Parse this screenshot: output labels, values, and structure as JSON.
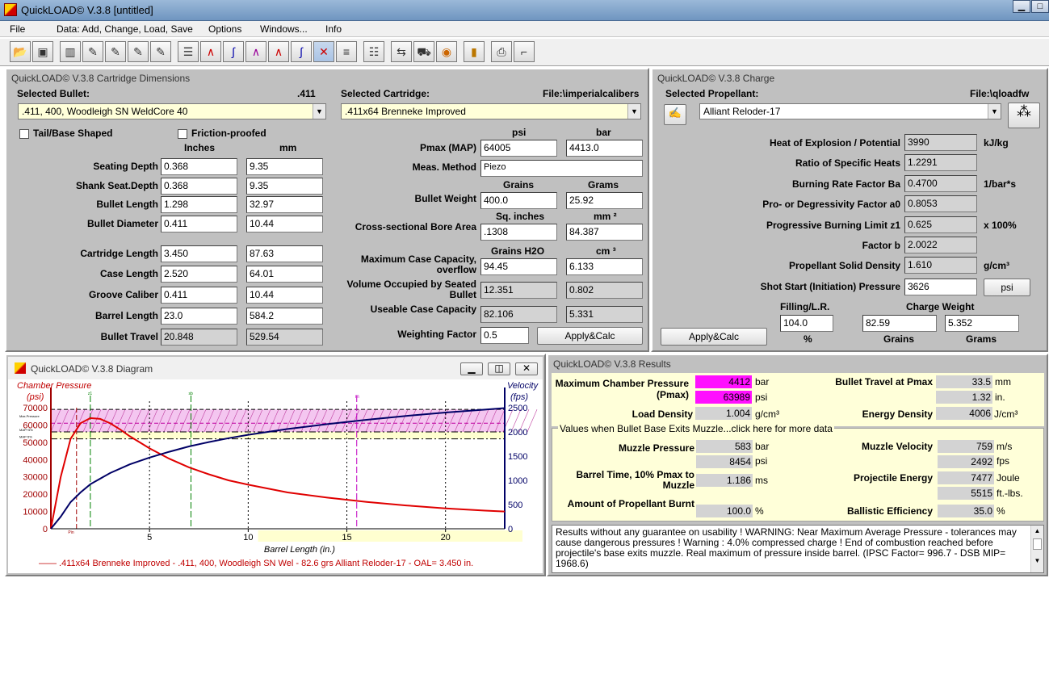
{
  "window": {
    "title": "QuickLOAD© V.3.8   [untitled]",
    "minimize": "▁",
    "maximize": "□"
  },
  "menu": [
    "File",
    "Data: Add, Change, Load, Save",
    "Options",
    "Windows...",
    "Info"
  ],
  "toolbar": {
    "icons": [
      "open-icon",
      "save-icon",
      "library-icon",
      "edit-bullet-icon",
      "edit-cartridge-icon",
      "edit-powder-icon",
      "edit-list-icon",
      "table-icon",
      "pressure-curve-icon",
      "velocity-curve-icon",
      "combined-curve-icon",
      "energy-curve-icon",
      "time-curve-icon",
      "diagram-icon",
      "list-icon",
      "sheet-icon",
      "compare-icon",
      "truck-icon",
      "bell-icon",
      "cartridges-icon",
      "printer-icon",
      "pistol-icon"
    ]
  },
  "dims": {
    "title": "QuickLOAD© V.3.8 Cartridge Dimensions",
    "bullet_label": "Selected Bullet:",
    "bullet_cal": ".411",
    "bullet": ".411, 400, Woodleigh SN WeldCore 40",
    "cart_label": "Selected Cartridge:",
    "cart_file": "File:\\imperialcalibers",
    "cartridge": ".411x64 Brenneke Improved",
    "tail": "Tail/Base Shaped",
    "friction": "Friction-proofed",
    "inches": "Inches",
    "mm": "mm",
    "rows": [
      {
        "label": "Seating Depth",
        "in": "0.368",
        "mm": "9.35"
      },
      {
        "label": "Shank Seat.Depth",
        "in": "0.368",
        "mm": "9.35"
      },
      {
        "label": "Bullet Length",
        "in": "1.298",
        "mm": "32.97"
      },
      {
        "label": "Bullet Diameter",
        "in": "0.411",
        "mm": "10.44"
      },
      {
        "label": "Cartridge Length",
        "in": "3.450",
        "mm": "87.63"
      },
      {
        "label": "Case Length",
        "in": "2.520",
        "mm": "64.01"
      },
      {
        "label": "Groove Caliber",
        "in": "0.411",
        "mm": "10.44"
      },
      {
        "label": "Barrel Length",
        "in": "23.0",
        "mm": "584.2"
      },
      {
        "label": "Bullet Travel",
        "in": "20.848",
        "mm": "529.54"
      }
    ],
    "psi": "psi",
    "bar": "bar",
    "pmax_label": "Pmax (MAP)",
    "pmax_psi": "64005",
    "pmax_bar": "4413.0",
    "meas_label": "Meas. Method",
    "meas": "Piezo",
    "grains": "Grains",
    "grams": "Grams",
    "bw_label": "Bullet Weight",
    "bw_gr": "400.0",
    "bw_g": "25.92",
    "sqin": "Sq. inches",
    "mm2": "mm ²",
    "bore_label": "Cross-sectional Bore Area",
    "bore_in": ".1308",
    "bore_mm": "84.387",
    "gh2o": "Grains H2O",
    "cm3": "cm ³",
    "cap_label1": "Maximum Case Capacity,",
    "cap_label2": "overflow",
    "cap_gr": "94.45",
    "cap_cm": "6.133",
    "vol_label1": "Volume Occupied by Seated",
    "vol_label2": "Bullet",
    "vol_gr": "12.351",
    "vol_cm": "0.802",
    "use_label": "Useable Case Capacity",
    "use_gr": "82.106",
    "use_cm": "5.331",
    "wf_label": "Weighting Factor",
    "wf": "0.5",
    "apply": "Apply&Calc"
  },
  "charge": {
    "title": "QuickLOAD© V.3.8 Charge",
    "prop_label": "Selected Propellant:",
    "file": "File:\\qloadfw",
    "propellant": "Alliant Reloder-17",
    "rows": [
      {
        "label": "Heat of Explosion / Potential",
        "value": "3990",
        "unit": "kJ/kg"
      },
      {
        "label": "Ratio of Specific Heats",
        "value": "1.2291",
        "unit": ""
      },
      {
        "label": "Burning Rate Factor  Ba",
        "value": "0.4700",
        "unit": "1/bar*s"
      },
      {
        "label": "Pro- or Degressivity Factor  a0",
        "value": "0.8053",
        "unit": ""
      },
      {
        "label": "Progressive Burning Limit z1",
        "value": "0.625",
        "unit": "x 100%"
      },
      {
        "label": "Factor  b",
        "value": "2.0022",
        "unit": ""
      },
      {
        "label": "Propellant Solid Density",
        "value": "1.610",
        "unit": "g/cm³"
      }
    ],
    "shot_label": "Shot Start (Initiation) Pressure",
    "shot": "3626",
    "shot_unit": "psi",
    "fill_label": "Filling/L.R.",
    "fill": "104.0",
    "pct": "%",
    "cw_label": "Charge Weight",
    "cw_gr": "82.59",
    "cw_g": "5.352",
    "grains": "Grains",
    "grams": "Grams",
    "apply": "Apply&Calc"
  },
  "diagram": {
    "title": "QuickLOAD© V.3.8 Diagram",
    "legend": "——  .411x64 Brenneke Improved - .411, 400, Woodleigh SN Wel - 82.6 grs Alliant Reloder-17 - OAL= 3.450 in.",
    "small_labels": {
      "z1": "z1",
      "sb": "sb",
      "m": "m",
      "pin": "Pin",
      "max": "Max.Pressure",
      "map": "MAP+5%",
      "mapm": "MAP-5%"
    }
  },
  "chart_data": {
    "type": "line",
    "title": "",
    "xlabel": "Barrel Length (in.)",
    "ylabel": "Chamber Pressure (psi)",
    "y2label": "Velocity (fps)",
    "xlim": [
      0,
      23
    ],
    "ylim": [
      0,
      70000
    ],
    "y2lim": [
      0,
      2500
    ],
    "xticks": [
      "5",
      "10",
      "15",
      "20"
    ],
    "yticks": [
      "0",
      "10000",
      "20000",
      "30000",
      "40000",
      "50000",
      "60000",
      "70000"
    ],
    "y2ticks": [
      "0",
      "500",
      "1000",
      "1500",
      "2000",
      "2500"
    ],
    "series": [
      {
        "axis": "y",
        "color": "#e00000",
        "x": [
          0,
          0.5,
          1,
          1.5,
          2,
          2.5,
          3,
          3.5,
          4,
          5,
          6,
          7,
          8,
          9,
          10,
          12,
          14,
          16,
          18,
          20,
          22,
          23
        ],
        "values": [
          0,
          30000,
          52000,
          61000,
          64000,
          63500,
          61000,
          57500,
          53500,
          46500,
          40500,
          35500,
          31500,
          28000,
          25500,
          21000,
          18000,
          15500,
          13500,
          11800,
          10500,
          10000
        ]
      },
      {
        "axis": "y2",
        "color": "#000066",
        "x": [
          0,
          0.5,
          1,
          1.5,
          2,
          3,
          4,
          5,
          6,
          7,
          8,
          9,
          10,
          12,
          14,
          16,
          18,
          20,
          22,
          23
        ],
        "values": [
          0,
          250,
          550,
          750,
          920,
          1150,
          1330,
          1470,
          1590,
          1700,
          1790,
          1870,
          1940,
          2060,
          2160,
          2250,
          2330,
          2400,
          2460,
          2492
        ]
      }
    ]
  },
  "results": {
    "title": "QuickLOAD© V.3.8 Results",
    "pmax_label1": "Maximum Chamber Pressure",
    "pmax_label2": "(Pmax)",
    "pmax_bar": "4412",
    "bar": "bar",
    "pmax_psi": "63989",
    "psi": "psi",
    "travel_label": "Bullet Travel at Pmax",
    "travel_mm": "33.5",
    "mm": "mm",
    "travel_in": "1.32",
    "in": "in.",
    "ld_label": "Load Density",
    "ld": "1.004",
    "gcm3": "g/cm³",
    "ed_label": "Energy Density",
    "ed": "4006",
    "jcm3": "J/cm³",
    "muzzle_header": "Values when Bullet Base Exits Muzzle...click here for more data",
    "mp_label": "Muzzle Pressure",
    "mp_bar": "583",
    "mp_psi": "8454",
    "mv_label": "Muzzle Velocity",
    "mv_ms": "759",
    "ms": "m/s",
    "mv_fps": "2492",
    "fps": "fps",
    "bt_label1": "Barrel Time, 10% Pmax to",
    "bt_label2": "Muzzle",
    "bt": "1.186",
    "msu": "ms",
    "pe_label": "Projectile Energy",
    "pe_j": "7477",
    "joule": "Joule",
    "pe_ft": "5515",
    "ftlbs": "ft.-lbs.",
    "burnt_label": "Amount of Propellant Burnt",
    "burnt": "100.0",
    "pct": "%",
    "be_label": "Ballistic Efficiency",
    "be": "35.0",
    "warning": "Results without any guarantee on usability !  WARNING: Near Maximum Average Pressure - tolerances may cause dangerous pressures !  Warning : 4.0% compressed charge !  End of combustion reached before projectile's base exits muzzle.  Real maximum of pressure inside barrel.  (IPSC Factor= 996.7 - DSB MIP= 1968.6)"
  }
}
